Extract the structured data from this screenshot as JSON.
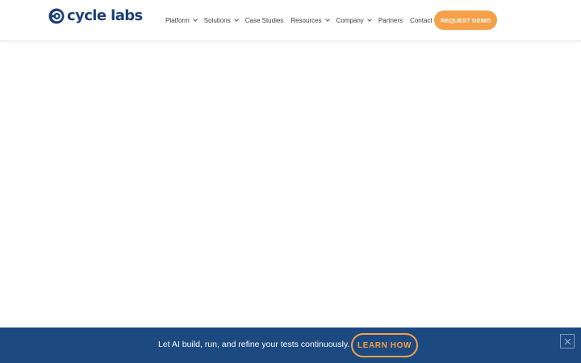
{
  "brand": {
    "logo_text": "cycle labs",
    "logo_icon": "cycle-labs-logo-icon",
    "color": "#1c4077"
  },
  "nav": {
    "items": [
      {
        "label": "Platform",
        "has_dropdown": true
      },
      {
        "label": "Solutions",
        "has_dropdown": true
      },
      {
        "label": "Case Studies",
        "has_dropdown": false
      },
      {
        "label": "Resources",
        "has_dropdown": true
      },
      {
        "label": "Company",
        "has_dropdown": true
      },
      {
        "label": "Partners",
        "has_dropdown": false
      },
      {
        "label": "Contact Us",
        "has_dropdown": false
      }
    ],
    "dropdown_icon": "chevron-down-icon"
  },
  "header": {
    "cta_label": "REQUEST DEMO",
    "cta_color": "#f6a04a"
  },
  "banner": {
    "text": "Let AI build, run, and refine your tests continuously.",
    "button_label": "LEARN HOW",
    "close_icon": "close-icon",
    "background": "#1c4a80",
    "accent": "#f6a04a"
  }
}
